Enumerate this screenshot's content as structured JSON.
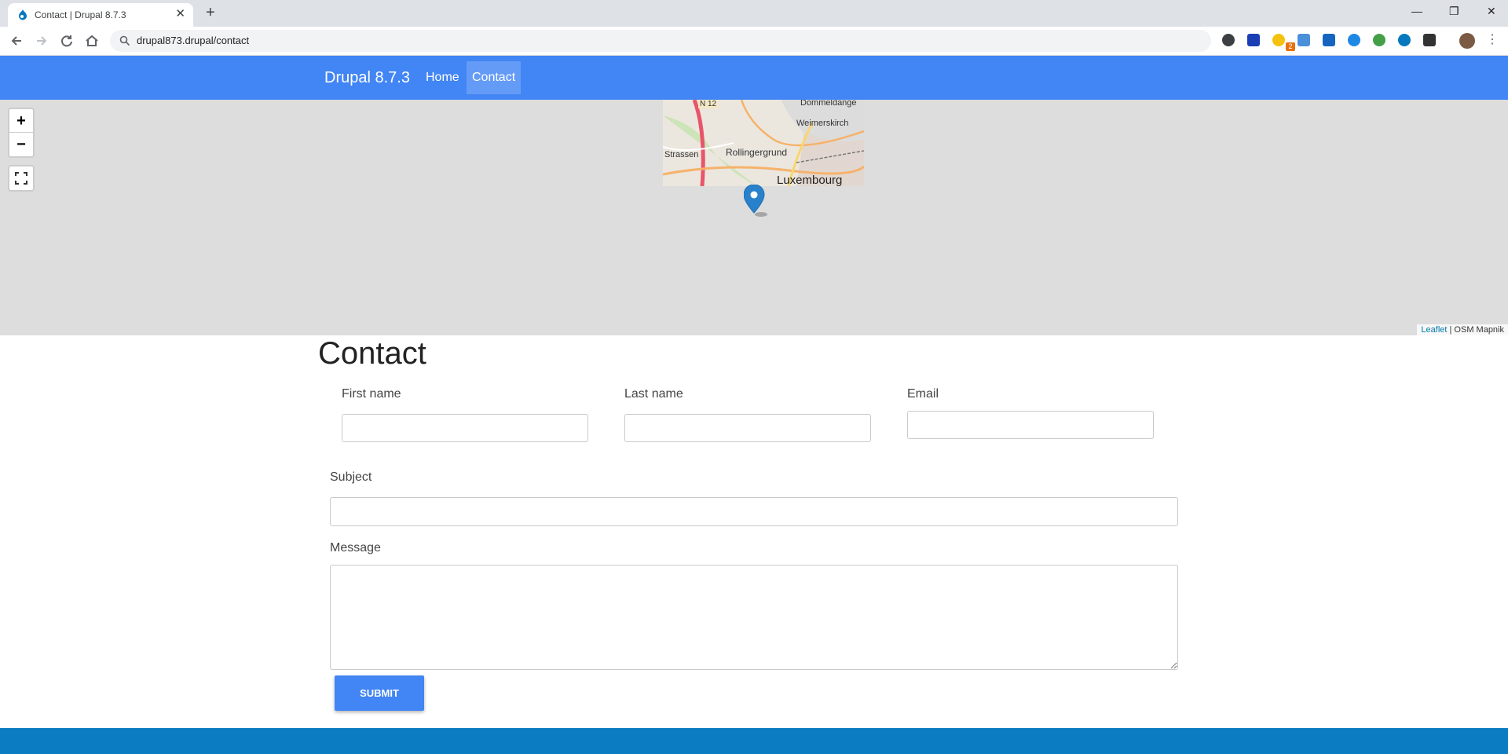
{
  "browser": {
    "tab_title": "Contact | Drupal 8.7.3",
    "tab_close": "✕",
    "new_tab": "+",
    "url": "drupal873.drupal/contact",
    "window_controls": [
      "—",
      "❐",
      "✕"
    ],
    "extension_badge": "2",
    "colors": {
      "tabstrip": "#dee1e6",
      "omnibox": "#f1f3f4"
    }
  },
  "site": {
    "name": "Drupal 8.7.3",
    "nav": [
      {
        "label": "Home",
        "active": false
      },
      {
        "label": "Contact",
        "active": true
      }
    ],
    "colors": {
      "header": "#4285f4",
      "footer": "#0b7cc2"
    }
  },
  "map": {
    "zoom_in": "+",
    "zoom_out": "−",
    "fullscreen_icon": "fullscreen-icon",
    "tile_labels": [
      "N 12",
      "Dommeldange",
      "Weimerskirch",
      "Strassen",
      "Rollingergrund",
      "Luxembourg"
    ],
    "attribution_link": "Leaflet",
    "attribution_separator": " | ",
    "attribution_text": "OSM Mapnik"
  },
  "contact": {
    "title": "Contact",
    "first_name_label": "First name",
    "last_name_label": "Last name",
    "email_label": "Email",
    "subject_label": "Subject",
    "message_label": "Message",
    "first_name_value": "",
    "last_name_value": "",
    "email_value": "",
    "subject_value": "",
    "message_value": "",
    "submit_label": "SUBMIT"
  }
}
